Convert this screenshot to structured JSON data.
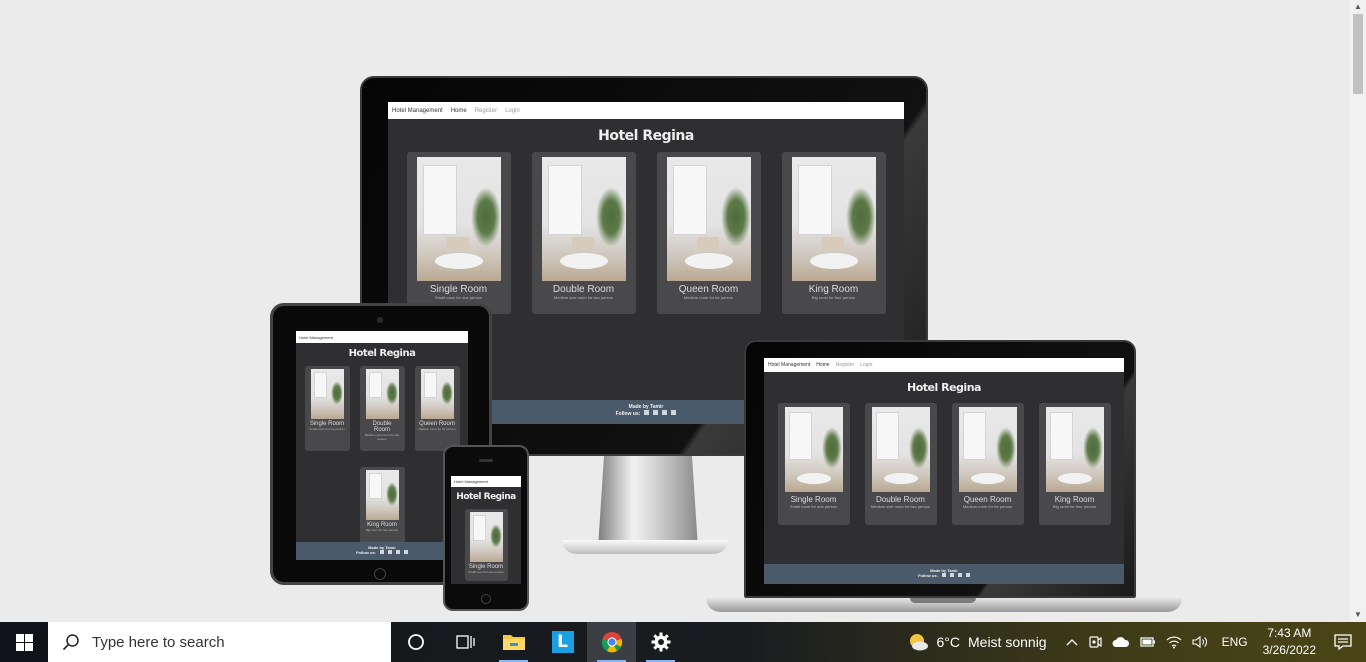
{
  "site": {
    "nav_brand": "Hotel Management",
    "nav_home": "Home",
    "nav_register": "Register",
    "nav_login": "Login",
    "title": "Hotel Regina",
    "rooms": [
      {
        "name": "Single Room",
        "desc": "Small room for one person"
      },
      {
        "name": "Double Room",
        "desc": "Medium size room for two person"
      },
      {
        "name": "Queen Room",
        "desc": "Medium room for for person"
      },
      {
        "name": "King Room",
        "desc": "Big room for four person"
      }
    ],
    "footer_made": "Made by Tamir",
    "footer_follow": "Follow us:"
  },
  "taskbar": {
    "search_placeholder": "Type here to search",
    "weather_temp": "6°C",
    "weather_text": "Meist sonnig",
    "language": "ENG",
    "time": "7:43 AM",
    "date": "3/26/2022"
  },
  "colors": {
    "screen_bg": "#2f2f31",
    "card_bg": "#49494b",
    "footer_bg": "#4a5a6a",
    "taskbar_bg": "#101418"
  },
  "icons": [
    "windows-start-icon",
    "search-icon",
    "cortana-icon",
    "task-view-icon",
    "file-explorer-icon",
    "l-app-icon",
    "chrome-icon",
    "settings-icon",
    "weather-icon",
    "chevron-up-icon",
    "meet-icon",
    "onedrive-icon",
    "battery-icon",
    "wifi-icon",
    "volume-icon",
    "notifications-icon"
  ]
}
